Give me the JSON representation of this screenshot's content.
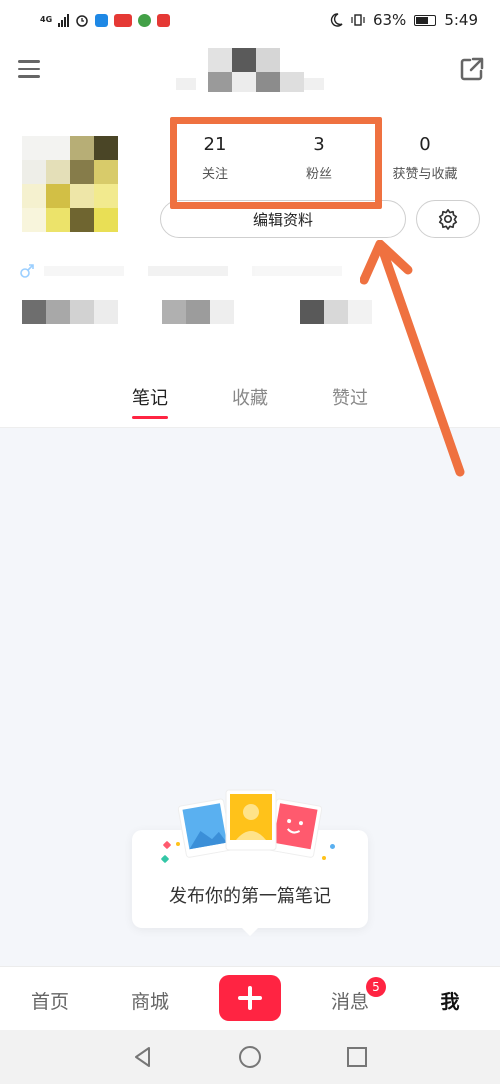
{
  "status_bar": {
    "network": "4G",
    "battery": "63%",
    "time": "5:49",
    "app_badges": [
      {
        "name": "shield-app-icon",
        "color": "#1e88e5"
      },
      {
        "name": "news-app-icon",
        "color": "#e53935"
      },
      {
        "name": "browser-app-icon",
        "color": "#43a047"
      },
      {
        "name": "note-app-icon",
        "color": "#e53935"
      }
    ]
  },
  "header": {
    "menu_icon": "menu-icon",
    "share_icon": "share-icon"
  },
  "profile": {
    "stats": [
      {
        "value": "21",
        "label": "关注"
      },
      {
        "value": "3",
        "label": "粉丝"
      },
      {
        "value": "0",
        "label": "获赞与收藏"
      }
    ],
    "edit_button_label": "编辑资料",
    "settings_icon": "gear-icon"
  },
  "tabs": [
    {
      "label": "笔记",
      "active": true
    },
    {
      "label": "收藏",
      "active": false
    },
    {
      "label": "赞过",
      "active": false
    }
  ],
  "empty_state": {
    "text": "发布你的第一篇笔记"
  },
  "bottom_nav": {
    "items": [
      {
        "label": "首页"
      },
      {
        "label": "商城"
      },
      {
        "label": "消息"
      },
      {
        "label": "我"
      }
    ],
    "message_badge": "5",
    "publish_icon": "plus-icon"
  },
  "colors": {
    "accent": "#ff2442",
    "annotation": "#ef7140"
  }
}
